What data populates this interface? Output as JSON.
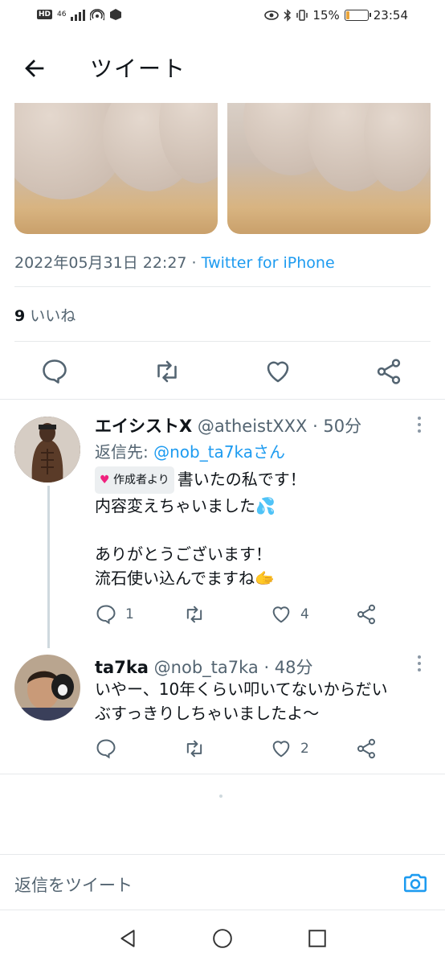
{
  "status_bar": {
    "network": "HD",
    "signal_text": "46",
    "battery_percent": "15%",
    "time": "23:54",
    "battery_level": 0.15,
    "battery_color": "#e8a33a"
  },
  "header": {
    "title": "ツイート"
  },
  "tweet": {
    "timestamp": "2022年05月31日 22:27 · ",
    "source": "Twitter for iPhone",
    "likes_count": "9",
    "likes_label": "いいね"
  },
  "replies": [
    {
      "name": "エイシストX",
      "handle": "@atheistXXX · 50分",
      "reply_to_label": "返信先: ",
      "reply_to_handle": "@nob_ta7kaさん",
      "badge": "作成者より",
      "lines": [
        "書いたの私です！",
        "内容変えちゃいました💦",
        "",
        "ありがとうございます！",
        "流石使い込んでますね🫱"
      ],
      "reply_count": "1",
      "retweet_count": "",
      "like_count": "4"
    },
    {
      "name": "ta7ka",
      "handle": "@nob_ta7ka · 48分",
      "lines": [
        "いやー、10年くらい叩いてないからだい",
        "ぶすっきりしちゃいましたよ〜"
      ],
      "reply_count": "",
      "retweet_count": "",
      "like_count": "2"
    }
  ],
  "compose": {
    "placeholder": "返信をツイート"
  },
  "colors": {
    "accent": "#1d9bf0",
    "muted": "#536471"
  }
}
